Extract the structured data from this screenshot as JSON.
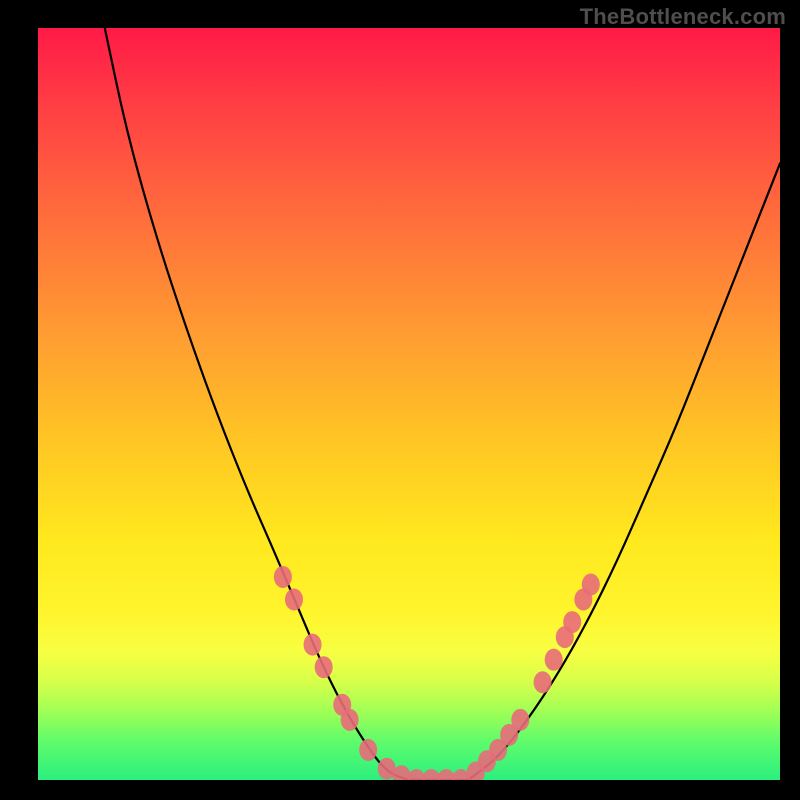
{
  "watermark": "TheBottleneck.com",
  "chart_data": {
    "type": "line",
    "title": "",
    "xlabel": "",
    "ylabel": "",
    "xlim": [
      0,
      100
    ],
    "ylim": [
      0,
      100
    ],
    "series": [
      {
        "name": "left-curve",
        "x": [
          9,
          12,
          16,
          20,
          24,
          28,
          32,
          35,
          38,
          41,
          44,
          47,
          50
        ],
        "y": [
          100,
          86,
          72,
          60,
          49,
          39,
          30,
          23,
          16,
          10,
          5,
          1,
          0
        ]
      },
      {
        "name": "right-curve",
        "x": [
          58,
          62,
          66,
          70,
          74,
          78,
          82,
          86,
          90,
          94,
          98,
          100
        ],
        "y": [
          0,
          3,
          8,
          14,
          21,
          29,
          38,
          47,
          57,
          67,
          77,
          82
        ]
      },
      {
        "name": "flat-bottom",
        "x": [
          50,
          58
        ],
        "y": [
          0,
          0
        ]
      }
    ],
    "markers": {
      "left": [
        {
          "x": 33,
          "y": 27
        },
        {
          "x": 34.5,
          "y": 24
        },
        {
          "x": 37,
          "y": 18
        },
        {
          "x": 38.5,
          "y": 15
        },
        {
          "x": 41,
          "y": 10
        },
        {
          "x": 42,
          "y": 8
        },
        {
          "x": 44.5,
          "y": 4
        },
        {
          "x": 47,
          "y": 1.5
        },
        {
          "x": 49,
          "y": 0.5
        },
        {
          "x": 51,
          "y": 0
        },
        {
          "x": 53,
          "y": 0
        },
        {
          "x": 55,
          "y": 0
        },
        {
          "x": 57,
          "y": 0
        }
      ],
      "right": [
        {
          "x": 59,
          "y": 1
        },
        {
          "x": 60.5,
          "y": 2.5
        },
        {
          "x": 62,
          "y": 4
        },
        {
          "x": 63.5,
          "y": 6
        },
        {
          "x": 65,
          "y": 8
        },
        {
          "x": 68,
          "y": 13
        },
        {
          "x": 69.5,
          "y": 16
        },
        {
          "x": 71,
          "y": 19
        },
        {
          "x": 72,
          "y": 21
        },
        {
          "x": 73.5,
          "y": 24
        },
        {
          "x": 74.5,
          "y": 26
        }
      ]
    },
    "marker_color": "#e86c7a",
    "curve_color": "#000000"
  },
  "frame": {
    "border_color": "#000000",
    "border_left": 38,
    "border_top": 28,
    "border_right": 20,
    "border_bottom": 20
  }
}
